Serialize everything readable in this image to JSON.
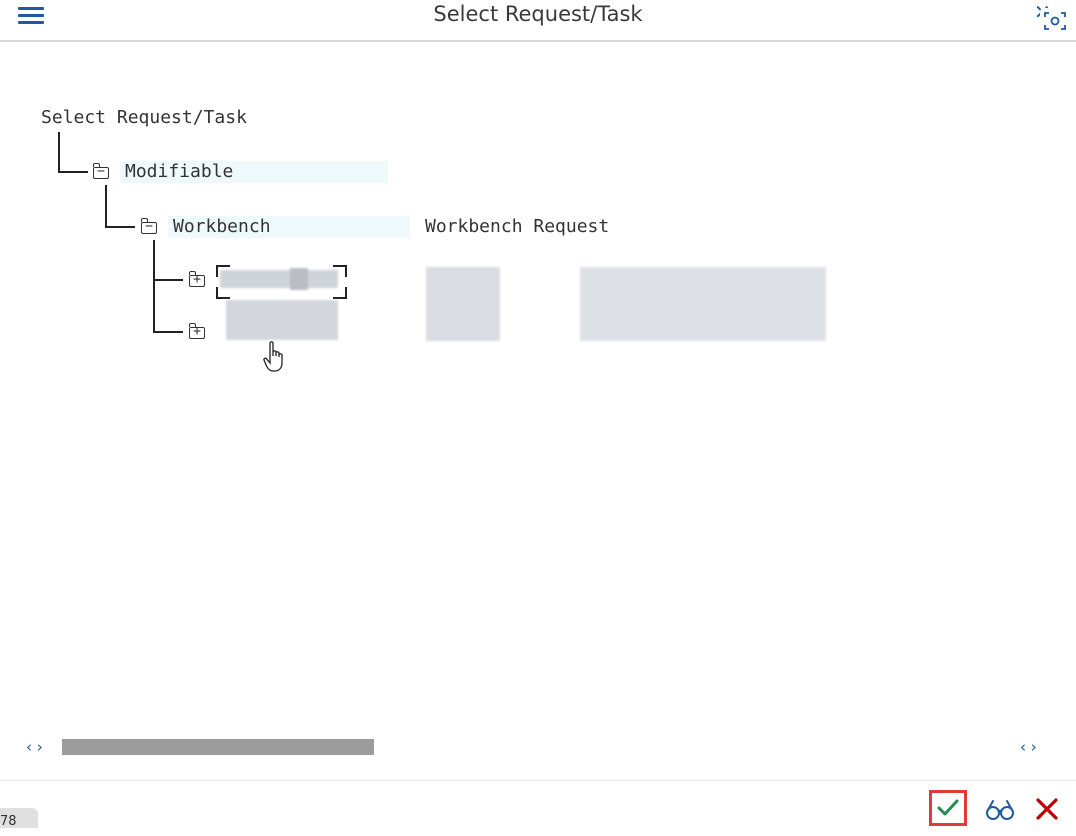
{
  "window": {
    "title": "Select Request/Task",
    "close_glyph": "✕"
  },
  "tree": {
    "root_label": "Select Request/Task",
    "modifiable_label": "Modifiable",
    "workbench_label": "Workbench",
    "workbench_desc": "Workbench Request",
    "expand_sign": "+",
    "collapse_sign": "−"
  },
  "scroll": {
    "left_arrows": "‹ ›",
    "right_arrows": "‹ ›"
  },
  "footer": {
    "status_text": "78"
  },
  "colors": {
    "accent": "#1f5a9e",
    "ok_green": "#1e8f4c",
    "cancel_red": "#bb0000",
    "highlight_frame": "#e03a3a"
  },
  "icons": [
    "menu-icon",
    "close-icon",
    "screenshot-icon",
    "folder-collapse-icon",
    "folder-expand-icon",
    "checkmark-icon",
    "glasses-icon",
    "cancel-x-icon",
    "hand-cursor-icon"
  ]
}
